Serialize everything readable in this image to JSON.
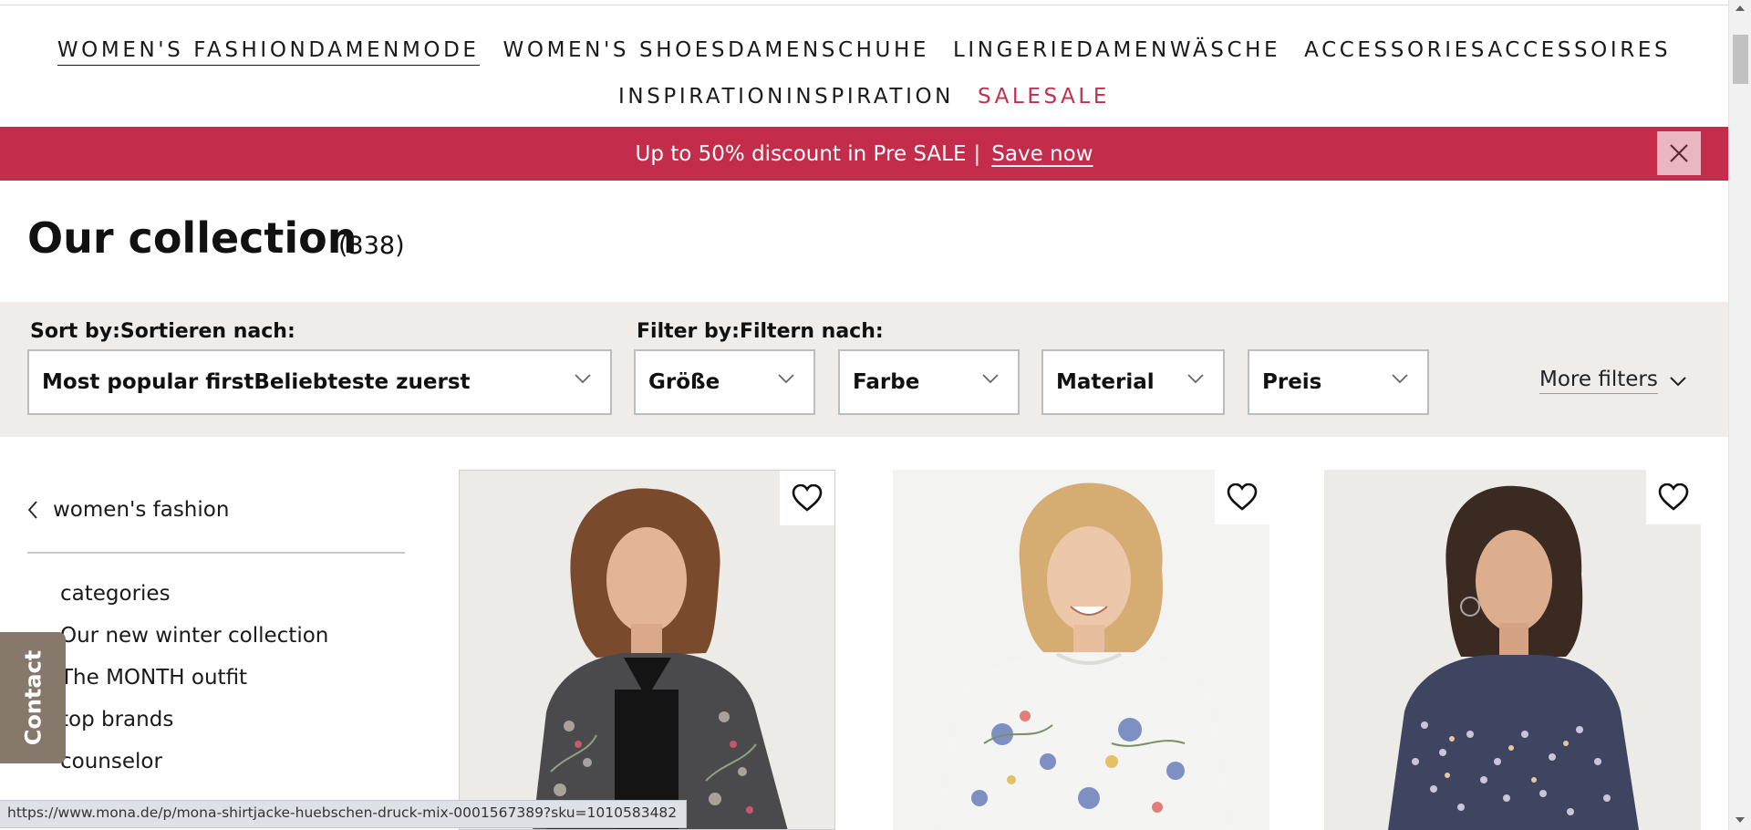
{
  "nav": {
    "row1": [
      {
        "label": "WOMEN'S FASHIONDAMENMODE"
      },
      {
        "label": "WOMEN'S SHOESDAMENSCHUHE"
      },
      {
        "label": "LINGERIEDAMENWÄSCHE"
      },
      {
        "label": "ACCESSORIESACCESSOIRES"
      }
    ],
    "row2": [
      {
        "label": "INSPIRATIONINSPIRATION"
      },
      {
        "label": "SALESALE"
      }
    ],
    "active": "WOMEN'S FASHIONDAMENMODE"
  },
  "promo": {
    "text": "Up to 50% discount in Pre SALE",
    "separator": "|",
    "link": "Save now",
    "close_icon": "close-icon"
  },
  "page": {
    "title": "Our collection",
    "count": "(338)"
  },
  "filters": {
    "sort_label": "Sort by:Sortieren nach:",
    "sort_value": "Most popular firstBeliebteste zuerst",
    "filter_label": "Filter by:Filtern nach:",
    "size": "Größe",
    "color": "Farbe",
    "material": "Material",
    "price": "Preis",
    "more": "More filters"
  },
  "sidebar": {
    "back_label": "women's fashion",
    "items": [
      {
        "label": "categories"
      },
      {
        "label": "Our new winter collection"
      },
      {
        "label": "The MONTH outfit"
      },
      {
        "label": "top brands"
      },
      {
        "label": "counselor"
      }
    ]
  },
  "contact": {
    "label": "Contact"
  },
  "products": [
    {
      "image": "woman-floral-bomber-jacket",
      "wishlist_icon": "heart-icon"
    },
    {
      "image": "woman-white-floral-sweater",
      "wishlist_icon": "heart-icon"
    },
    {
      "image": "woman-ditsy-floral-blouse",
      "wishlist_icon": "heart-icon"
    }
  ],
  "status_bar": {
    "url": "https://www.mona.de/p/mona-shirtjacke-huebschen-druck-mix-0001567389?sku=1010583482"
  },
  "colors": {
    "promo_bg": "#c42c4b",
    "sale_accent": "#c1304f",
    "filter_bar_bg": "#efecea",
    "contact_bg": "#86786a"
  }
}
